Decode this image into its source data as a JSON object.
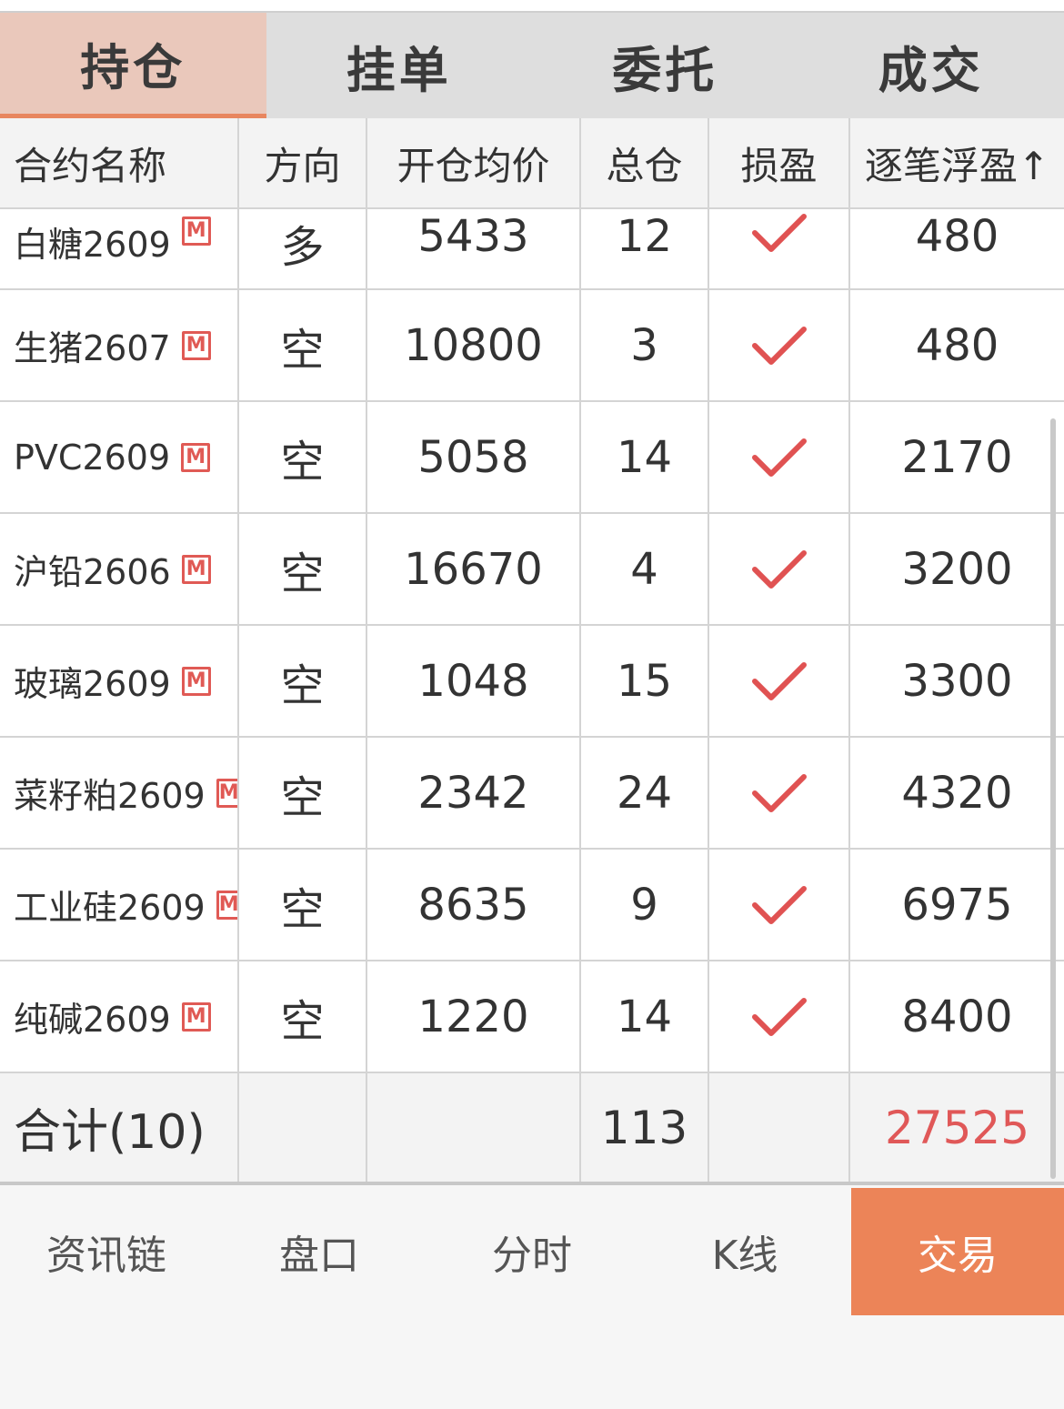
{
  "tabs": [
    {
      "label": "持仓",
      "active": true
    },
    {
      "label": "挂单",
      "active": false
    },
    {
      "label": "委托",
      "active": false
    },
    {
      "label": "成交",
      "active": false
    }
  ],
  "columns": {
    "name": "合约名称",
    "direction": "方向",
    "avg_price": "开仓均价",
    "total": "总仓",
    "stop": "损盈",
    "float_pnl": "逐笔浮盈↑"
  },
  "badge_label": "M",
  "rows": [
    {
      "name": "白糖2609",
      "direction": "多",
      "side": "long",
      "avg_price": "5433",
      "total": "12",
      "float_pnl": "480"
    },
    {
      "name": "生猪2607",
      "direction": "空",
      "side": "short",
      "avg_price": "10800",
      "total": "3",
      "float_pnl": "480"
    },
    {
      "name": "PVC2609",
      "direction": "空",
      "side": "short",
      "avg_price": "5058",
      "total": "14",
      "float_pnl": "2170"
    },
    {
      "name": "沪铅2606",
      "direction": "空",
      "side": "short",
      "avg_price": "16670",
      "total": "4",
      "float_pnl": "3200"
    },
    {
      "name": "玻璃2609",
      "direction": "空",
      "side": "short",
      "avg_price": "1048",
      "total": "15",
      "float_pnl": "3300"
    },
    {
      "name": "菜籽粕2609",
      "direction": "空",
      "side": "short",
      "avg_price": "2342",
      "total": "24",
      "float_pnl": "4320"
    },
    {
      "name": "工业硅2609",
      "direction": "空",
      "side": "short",
      "avg_price": "8635",
      "total": "9",
      "float_pnl": "6975"
    },
    {
      "name": "纯碱2609",
      "direction": "空",
      "side": "short",
      "avg_price": "1220",
      "total": "14",
      "float_pnl": "8400"
    }
  ],
  "summary": {
    "label": "合计(10)",
    "total": "113",
    "float_pnl": "27525"
  },
  "nav": [
    {
      "label": "资讯链",
      "active": false
    },
    {
      "label": "盘口",
      "active": false
    },
    {
      "label": "分时",
      "active": false
    },
    {
      "label": "K线",
      "active": false
    },
    {
      "label": "交易",
      "active": true
    }
  ],
  "colors": {
    "active_tab_bg": "#eac8bb",
    "accent": "#ec8458",
    "long": "#e05252",
    "short": "#2e9f5e",
    "profit": "#e05858"
  }
}
